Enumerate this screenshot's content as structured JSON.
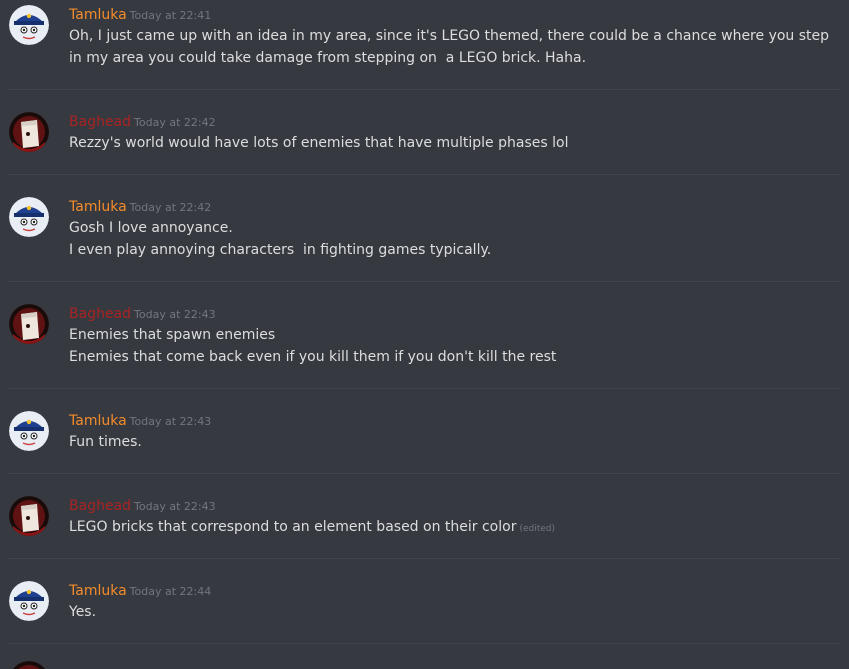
{
  "colors": {
    "background": "#36393f",
    "message_text": "#dcddde",
    "timestamp": "#72767d",
    "divider": "#40434a",
    "tamluka": "#f48c2c",
    "baghead": "#a82424"
  },
  "messages": [
    {
      "author": "Tamluka",
      "author_color": "#f48c2c",
      "avatar": "captain-avatar-icon",
      "timestamp": "Today at 22:41",
      "lines": [
        "Oh, I just came up with an idea in my area, since it's LEGO themed, there could be a chance where you step in my area you could take damage from stepping on  a LEGO brick. Haha."
      ]
    },
    {
      "author": "Baghead",
      "author_color": "#a82424",
      "avatar": "baghead-avatar-icon",
      "timestamp": "Today at 22:42",
      "lines": [
        "Rezzy's world would have lots of enemies that have multiple phases lol"
      ]
    },
    {
      "author": "Tamluka",
      "author_color": "#f48c2c",
      "avatar": "captain-avatar-icon",
      "timestamp": "Today at 22:42",
      "lines": [
        "Gosh I love annoyance.",
        "I even play annoying characters  in fighting games typically."
      ]
    },
    {
      "author": "Baghead",
      "author_color": "#a82424",
      "avatar": "baghead-avatar-icon",
      "timestamp": "Today at 22:43",
      "lines": [
        "Enemies that spawn enemies",
        "Enemies that come back even if you kill them if you don't kill the rest"
      ]
    },
    {
      "author": "Tamluka",
      "author_color": "#f48c2c",
      "avatar": "captain-avatar-icon",
      "timestamp": "Today at 22:43",
      "lines": [
        "Fun times."
      ]
    },
    {
      "author": "Baghead",
      "author_color": "#a82424",
      "avatar": "baghead-avatar-icon",
      "timestamp": "Today at 22:43",
      "lines": [
        "LEGO bricks that correspond to an element based on their color"
      ],
      "edited": "(edited)"
    },
    {
      "author": "Tamluka",
      "author_color": "#f48c2c",
      "avatar": "captain-avatar-icon",
      "timestamp": "Today at 22:44",
      "lines": [
        "Yes."
      ]
    }
  ]
}
